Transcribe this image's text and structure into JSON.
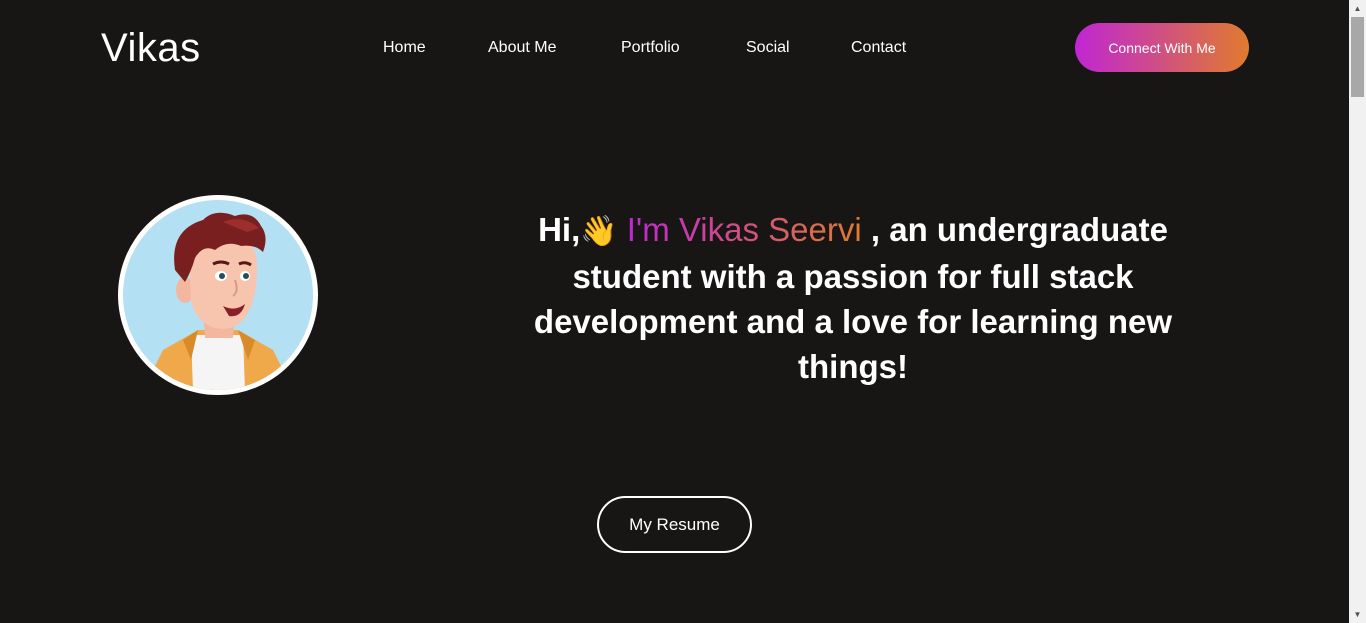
{
  "header": {
    "logo": "Vikas",
    "nav": [
      {
        "label": "Home"
      },
      {
        "label": "About Me"
      },
      {
        "label": "Portfolio"
      },
      {
        "label": "Social"
      },
      {
        "label": "Contact"
      }
    ],
    "cta_label": "Connect With Me"
  },
  "hero": {
    "greeting": "Hi,",
    "wave_emoji": "👋",
    "name": "I'm Vikas Seervi",
    "tagline": ", an undergraduate student with a passion for full stack development and a love for learning new things!",
    "resume_label": "My Resume"
  },
  "colors": {
    "background": "#171615",
    "gradient_start": "#c026d3",
    "gradient_end": "#e07b2e",
    "text": "#ffffff"
  }
}
